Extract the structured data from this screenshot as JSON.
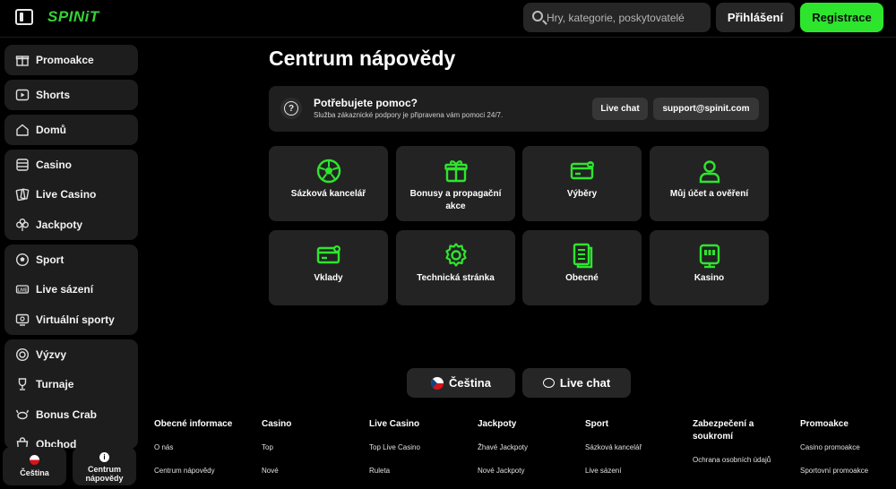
{
  "header": {
    "logo": "SPINiT",
    "search_placeholder": "Hry, kategorie, poskytovatelé",
    "login_label": "Přihlášení",
    "register_label": "Registrace"
  },
  "sidebar": {
    "groups": [
      {
        "items": [
          {
            "label": "Promoakce",
            "icon": "gift-icon"
          }
        ]
      },
      {
        "items": [
          {
            "label": "Shorts",
            "icon": "play-icon"
          }
        ]
      },
      {
        "items": [
          {
            "label": "Domů",
            "icon": "home-icon"
          }
        ]
      },
      {
        "items": [
          {
            "label": "Casino",
            "icon": "slot-icon"
          },
          {
            "label": "Live Casino",
            "icon": "cards-icon"
          },
          {
            "label": "Jackpoty",
            "icon": "clover-icon"
          }
        ]
      },
      {
        "items": [
          {
            "label": "Sport",
            "icon": "ball-icon"
          },
          {
            "label": "Live sázení",
            "icon": "live-icon"
          },
          {
            "label": "Virtuální sporty",
            "icon": "monitor-icon"
          }
        ]
      },
      {
        "items": [
          {
            "label": "Výzvy",
            "icon": "target-icon"
          },
          {
            "label": "Turnaje",
            "icon": "trophy-icon"
          },
          {
            "label": "Bonus Crab",
            "icon": "crab-icon"
          },
          {
            "label": "Obchod",
            "icon": "shop-icon"
          }
        ]
      }
    ],
    "bottom_language": "Čeština",
    "bottom_help": "Centrum nápovědy"
  },
  "main": {
    "title": "Centrum nápovědy",
    "help": {
      "title": "Potřebujete pomoc?",
      "subtitle": "Služba zákaznické podpory je připravena vám pomoci 24/7.",
      "chat_label": "Live chat",
      "email_label": "support@spinit.com"
    },
    "cards": [
      {
        "label": "Sázková kancelář",
        "icon": "football-icon"
      },
      {
        "label": "Bonusy a propagační akce",
        "icon": "gift-icon"
      },
      {
        "label": "Výběry",
        "icon": "card-withdraw-icon"
      },
      {
        "label": "Můj účet a ověření",
        "icon": "user-icon"
      },
      {
        "label": "Vklady",
        "icon": "card-deposit-icon"
      },
      {
        "label": "Technická stránka",
        "icon": "gear-icon"
      },
      {
        "label": "Obecné",
        "icon": "document-icon"
      },
      {
        "label": "Kasino",
        "icon": "slot-machine-icon"
      }
    ],
    "language_button": "Čeština",
    "chat_button": "Live chat"
  },
  "footer": {
    "columns": [
      {
        "title": "Obecné informace",
        "links": [
          "O nás",
          "Centrum nápovědy"
        ]
      },
      {
        "title": "Casino",
        "links": [
          "Top",
          "Nové"
        ]
      },
      {
        "title": "Live Casino",
        "links": [
          "Top Live Casino",
          "Ruleta"
        ]
      },
      {
        "title": "Jackpoty",
        "links": [
          "Žhavé Jackpoty",
          "Nové Jackpoty"
        ]
      },
      {
        "title": "Sport",
        "links": [
          "Sázková kancelář",
          "Live sázení"
        ]
      },
      {
        "title": "Zabezpečení a soukromí",
        "links": [
          "Ochrana osobních údajů"
        ]
      },
      {
        "title": "Promoakce",
        "links": [
          "Casino promoakce",
          "Sportovní promoakce"
        ]
      }
    ]
  },
  "colors": {
    "accent": "#2ee52e",
    "background": "#000000",
    "card": "#232323"
  }
}
